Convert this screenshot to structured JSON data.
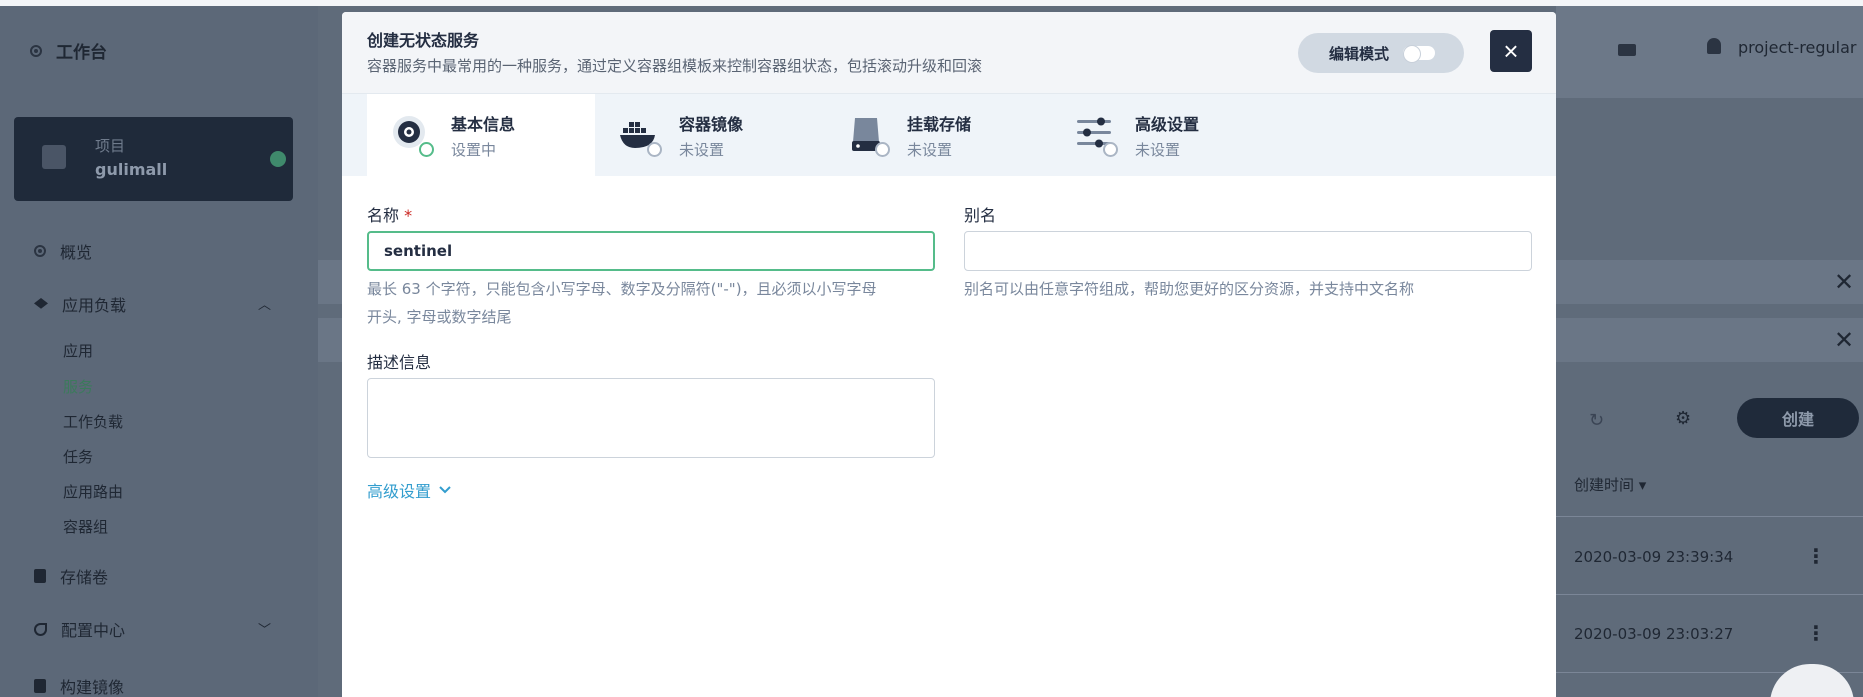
{
  "background": {
    "sidebar": {
      "workbench_label": "工作台",
      "project": {
        "label": "项目",
        "name": "gulimall"
      },
      "nav": [
        {
          "label": "概览"
        },
        {
          "label": "应用负载"
        },
        {
          "label": "存储卷"
        },
        {
          "label": "配置中心"
        },
        {
          "label": "构建镜像"
        }
      ],
      "sub_items": [
        "应用",
        "服务",
        "工作负载",
        "任务",
        "应用路由",
        "容器组"
      ]
    },
    "header": {
      "user": "project-regular"
    },
    "toolbar": {
      "create_label": "创建"
    },
    "table": {
      "created_header": "创建时间",
      "rows": [
        {
          "created": "2020-03-09 23:39:34"
        },
        {
          "created": "2020-03-09 23:03:27"
        }
      ]
    }
  },
  "modal": {
    "title": "创建无状态服务",
    "description": "容器服务中最常用的一种服务，通过定义容器组模板来控制容器组状态，包括滚动升级和回滚",
    "edit_mode_label": "编辑模式",
    "close_symbol": "×",
    "steps": [
      {
        "title": "基本信息",
        "status": "设置中"
      },
      {
        "title": "容器镜像",
        "status": "未设置"
      },
      {
        "title": "挂载存储",
        "status": "未设置"
      },
      {
        "title": "高级设置",
        "status": "未设置"
      }
    ],
    "form": {
      "name_label": "名称",
      "required_mark": "*",
      "name_value": "sentinel",
      "name_hint_line1": "最长 63 个字符，只能包含小写字母、数字及分隔符(\"-\")，且必须以小写字母",
      "name_hint_line2": "开头, 字母或数字结尾",
      "alias_label": "别名",
      "alias_value": "",
      "alias_hint": "别名可以由任意字符组成，帮助您更好的区分资源，并支持中文名称",
      "description_label": "描述信息",
      "description_value": "",
      "advanced_link": "高级设置"
    }
  },
  "colors": {
    "accent_green": "#55bc8a",
    "link_blue": "#329dce",
    "dark": "#242e42"
  }
}
